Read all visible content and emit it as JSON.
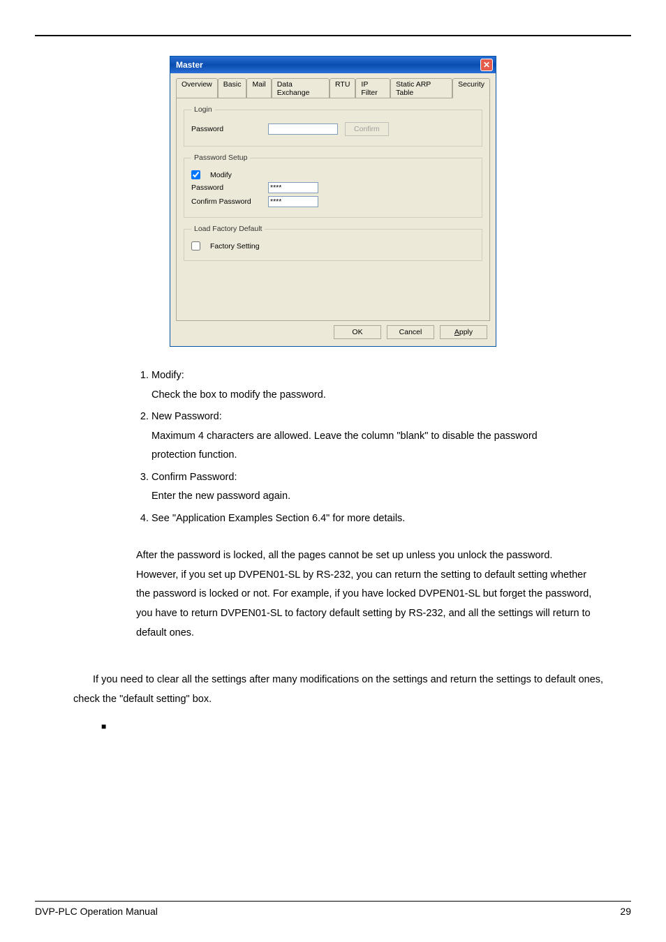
{
  "dialog": {
    "title": "Master",
    "tabs": [
      "Overview",
      "Basic",
      "Mail",
      "Data Exchange",
      "RTU",
      "IP Filter",
      "Static ARP Table",
      "Security"
    ],
    "active_tab_index": 7,
    "login": {
      "legend": "Login",
      "password_label": "Password",
      "password_value": "",
      "confirm_btn": "Confirm"
    },
    "password_setup": {
      "legend": "Password Setup",
      "modify_label": "Modify",
      "modify_checked": true,
      "password_label": "Password",
      "password_value": "****",
      "confirm_label": "Confirm Password",
      "confirm_value": "****"
    },
    "factory": {
      "legend": "Load Factory Default",
      "factory_label": "Factory Setting",
      "factory_checked": false
    },
    "buttons": {
      "ok": "OK",
      "cancel": "Cancel",
      "apply": "Apply"
    }
  },
  "list": {
    "i1_t": "Modify:",
    "i1_d": "Check the box to modify the password.",
    "i2_t": "New Password:",
    "i2_d": "Maximum 4 characters are allowed. Leave the column \"blank\" to disable the password protection function.",
    "i3_t": "Confirm Password:",
    "i3_d": "Enter the new password again.",
    "i4_t": "See \"Application Examples Section 6.4\" for more details."
  },
  "para1": "After the password is locked, all the pages cannot be set up unless you unlock the password. However, if you set up DVPEN01-SL by RS-232, you can return the setting to default setting whether the password is locked or not. For example, if you have locked DVPEN01-SL but forget the password, you have to return DVPEN01-SL to factory default setting by RS-232, and all the settings will return to default ones.",
  "para2": "If you need to clear all the settings after many modifications on the settings and return the settings to default ones, check the \"default setting\" box.",
  "footer": {
    "left": "DVP-PLC Operation Manual",
    "right": "29"
  }
}
